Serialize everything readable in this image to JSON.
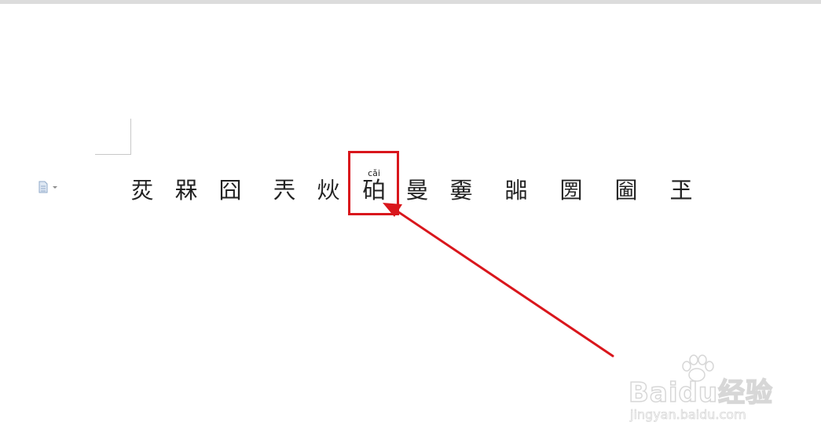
{
  "document": {
    "characters": [
      "烎",
      "槑",
      "囧",
      "兲",
      "炏",
      "砶",
      "曼",
      "嫑",
      "嘂",
      "圐",
      "圙",
      "玊"
    ],
    "annotated_character": {
      "index": 5,
      "pinyin": "cǎi"
    }
  },
  "annotation": {
    "highlight_color": "#d9161c",
    "arrow_color": "#d9161c"
  },
  "watermark": {
    "logo_text": "Baidu经验",
    "url": "jingyan.baidu.com"
  },
  "icons": {
    "paragraph_options": "document-options-icon"
  }
}
